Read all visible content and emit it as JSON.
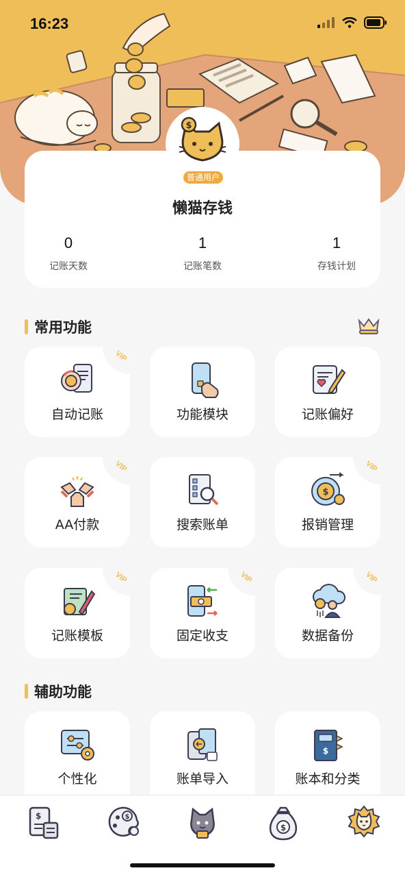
{
  "status_bar": {
    "time": "16:23"
  },
  "profile": {
    "badge": "普通用户",
    "name": "懒猫存钱",
    "stats": [
      {
        "value": "0",
        "label": "记账天数"
      },
      {
        "value": "1",
        "label": "记账笔数"
      },
      {
        "value": "1",
        "label": "存钱计划"
      }
    ]
  },
  "sections": {
    "common": {
      "title": "常用功能",
      "items": [
        {
          "label": "自动记账",
          "vip": true,
          "icon": "auto-bookkeeping-icon"
        },
        {
          "label": "功能模块",
          "vip": false,
          "icon": "function-module-icon"
        },
        {
          "label": "记账偏好",
          "vip": false,
          "icon": "bookkeeping-preference-icon"
        },
        {
          "label": "AA付款",
          "vip": true,
          "icon": "aa-payment-icon"
        },
        {
          "label": "搜索账单",
          "vip": false,
          "icon": "search-bill-icon"
        },
        {
          "label": "报销管理",
          "vip": true,
          "icon": "reimbursement-icon"
        },
        {
          "label": "记账模板",
          "vip": true,
          "icon": "template-icon"
        },
        {
          "label": "固定收支",
          "vip": true,
          "icon": "fixed-income-expense-icon"
        },
        {
          "label": "数据备份",
          "vip": true,
          "icon": "data-backup-icon"
        }
      ]
    },
    "assist": {
      "title": "辅助功能",
      "items": [
        {
          "label": "个性化",
          "vip": false,
          "icon": "personalize-icon"
        },
        {
          "label": "账单导入",
          "vip": false,
          "icon": "bill-import-icon"
        },
        {
          "label": "账本和分类",
          "vip": false,
          "icon": "ledger-category-icon"
        }
      ]
    }
  },
  "vip_label": "VIP",
  "tabs": [
    {
      "name": "tab-bills",
      "icon": "bill-calculator-icon"
    },
    {
      "name": "tab-finance",
      "icon": "coin-palette-icon"
    },
    {
      "name": "tab-cat",
      "icon": "cat-icon"
    },
    {
      "name": "tab-savings",
      "icon": "money-bag-icon"
    },
    {
      "name": "tab-mine",
      "icon": "cat-face-sun-icon"
    }
  ],
  "colors": {
    "accent": "#f0be58",
    "badge": "#f0a93a",
    "background": "#f6f6f6"
  }
}
